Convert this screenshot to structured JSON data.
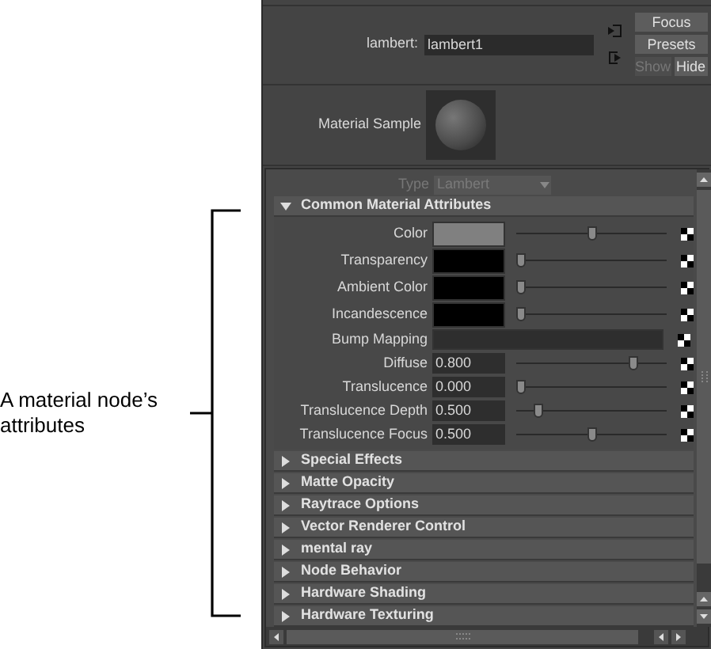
{
  "callout": {
    "text": "A material node’s attributes"
  },
  "node": {
    "label": "lambert:",
    "value": "lambert1"
  },
  "buttons": [
    {
      "label": "Focus",
      "disabled": false
    },
    {
      "label": "Presets",
      "disabled": false
    }
  ],
  "toggle": [
    {
      "label": "Show",
      "selected": false
    },
    {
      "label": "Hide",
      "selected": true
    }
  ],
  "sample": {
    "label": "Material Sample"
  },
  "type_field": {
    "label": "Type",
    "value": "Lambert",
    "disabled": true
  },
  "sections": [
    {
      "title": "Common Material Attributes",
      "expanded": true,
      "rows": [
        {
          "kind": "swatch",
          "label": "Color",
          "color": "#808080",
          "level": 0.5
        },
        {
          "kind": "swatch",
          "label": "Transparency",
          "color": "#000000",
          "level": 0
        },
        {
          "kind": "swatch",
          "label": "Ambient Color",
          "color": "#000000",
          "level": 0
        },
        {
          "kind": "swatch",
          "label": "Incandescence",
          "color": "#000000",
          "level": 0
        },
        {
          "kind": "map",
          "label": "Bump Mapping"
        },
        {
          "kind": "number",
          "label": "Diffuse",
          "value": "0.800",
          "level": 0.8
        },
        {
          "kind": "number",
          "label": "Translucence",
          "value": "0.000",
          "level": 0
        },
        {
          "kind": "number",
          "label": "Translucence Depth",
          "value": "0.500",
          "level": 0.12
        },
        {
          "kind": "number",
          "label": "Translucence Focus",
          "value": "0.500",
          "level": 0.5
        }
      ]
    },
    {
      "title": "Special Effects",
      "expanded": false
    },
    {
      "title": "Matte Opacity",
      "expanded": false
    },
    {
      "title": "Raytrace Options",
      "expanded": false
    },
    {
      "title": "Vector Renderer Control",
      "expanded": false
    },
    {
      "title": "mental ray",
      "expanded": false
    },
    {
      "title": "Node Behavior",
      "expanded": false
    },
    {
      "title": "Hardware Shading",
      "expanded": false
    },
    {
      "title": "Hardware Texturing",
      "expanded": false
    }
  ]
}
